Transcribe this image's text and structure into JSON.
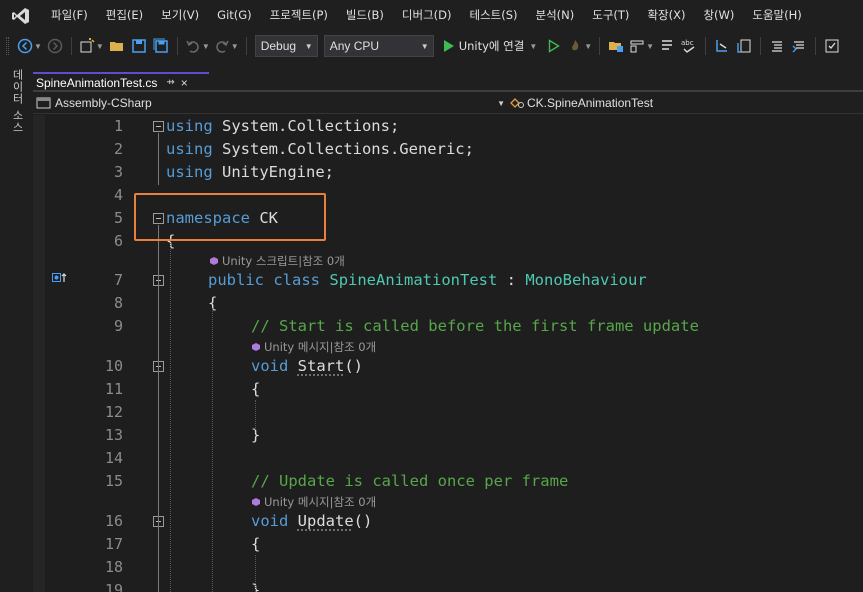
{
  "menu": {
    "items": [
      "파일(F)",
      "편집(E)",
      "보기(V)",
      "Git(G)",
      "프로젝트(P)",
      "빌드(B)",
      "디버그(D)",
      "테스트(S)",
      "분석(N)",
      "도구(T)",
      "확장(X)",
      "창(W)",
      "도움말(H)"
    ]
  },
  "toolbar": {
    "config": "Debug",
    "platform": "Any CPU",
    "run_label": "Unity에 연결"
  },
  "side": {
    "tab_label": "데이터 소스"
  },
  "tabs": [
    {
      "label": "SpineAnimationTest.cs",
      "pin": "⇸",
      "close": "×"
    }
  ],
  "nav": {
    "project": "Assembly-CSharp",
    "member": "CK.SpineAnimationTest"
  },
  "codelens": {
    "class_refs": "Unity 스크립트|참조 0개",
    "start_refs": "Unity 메시지|참조 0개",
    "update_refs": "Unity 메시지|참조 0개"
  },
  "lines": [
    {
      "n": "1",
      "tokens": [
        [
          "kw",
          "using"
        ],
        [
          "",
          " System.Collections;"
        ]
      ]
    },
    {
      "n": "2",
      "tokens": [
        [
          "kw",
          "using"
        ],
        [
          "",
          " System.Collections.Generic;"
        ]
      ]
    },
    {
      "n": "3",
      "tokens": [
        [
          "kw",
          "using"
        ],
        [
          "",
          " UnityEngine;"
        ]
      ]
    },
    {
      "n": "4",
      "tokens": []
    },
    {
      "n": "5",
      "tokens": [
        [
          "kw",
          "namespace"
        ],
        [
          "",
          " CK"
        ]
      ]
    },
    {
      "n": "6",
      "tokens": [
        [
          "",
          "{"
        ]
      ]
    },
    {
      "n": "7",
      "tokens": [
        [
          "kw",
          "public"
        ],
        [
          "",
          " "
        ],
        [
          "kw",
          "class"
        ],
        [
          "",
          " "
        ],
        [
          "type",
          "SpineAnimationTest"
        ],
        [
          "",
          " : "
        ],
        [
          "type",
          "MonoBehaviour"
        ]
      ]
    },
    {
      "n": "8",
      "tokens": [
        [
          "",
          "{"
        ]
      ]
    },
    {
      "n": "9",
      "tokens": [
        [
          "comment",
          "// Start is called before the first frame update"
        ]
      ]
    },
    {
      "n": "10",
      "tokens": [
        [
          "kw",
          "void"
        ],
        [
          "",
          " "
        ],
        [
          "method",
          "Start"
        ],
        [
          "",
          "()"
        ]
      ]
    },
    {
      "n": "11",
      "tokens": [
        [
          "",
          "{"
        ]
      ]
    },
    {
      "n": "12",
      "tokens": []
    },
    {
      "n": "13",
      "tokens": [
        [
          "",
          "}"
        ]
      ]
    },
    {
      "n": "14",
      "tokens": []
    },
    {
      "n": "15",
      "tokens": [
        [
          "comment",
          "// Update is called once per frame"
        ]
      ]
    },
    {
      "n": "16",
      "tokens": [
        [
          "kw",
          "void"
        ],
        [
          "",
          " "
        ],
        [
          "method",
          "Update"
        ],
        [
          "",
          "()"
        ]
      ]
    },
    {
      "n": "17",
      "tokens": [
        [
          "",
          "{"
        ]
      ]
    },
    {
      "n": "18",
      "tokens": []
    },
    {
      "n": "19",
      "tokens": [
        [
          "",
          "}"
        ]
      ]
    }
  ],
  "colors": {
    "keyword": "#569cd6",
    "type": "#4ec9b0",
    "comment": "#57a64a",
    "highlight": "#e8803a",
    "tab_accent": "#5d4fcc"
  }
}
